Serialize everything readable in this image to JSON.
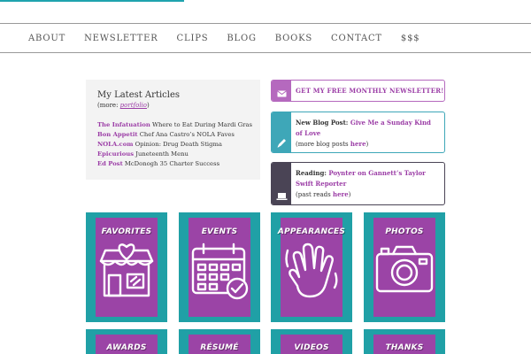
{
  "nav": {
    "items": [
      "ABOUT",
      "NEWSLETTER",
      "CLIPS",
      "BLOG",
      "BOOKS",
      "CONTACT",
      "$$$"
    ]
  },
  "articles": {
    "title": "My Latest Articles",
    "more_prefix": "(more: ",
    "more_link": "portfolio",
    "more_suffix": ")",
    "items": [
      {
        "source": "The Infatuation",
        "text": " Where to Eat During Mardi Gras"
      },
      {
        "source": "Bon Appetit",
        "text": " Chef Ana Castro’s NOLA Faves"
      },
      {
        "source": "NOLA.com",
        "text": " Opinion: Drug Death Stigma"
      },
      {
        "source": "Epicurious",
        "text": " Juneteenth Menu"
      },
      {
        "source": "Ed Post",
        "text": " McDonogh 35 Charter Success"
      }
    ]
  },
  "callouts": {
    "newsletter": {
      "label": "GET MY FREE MONTHLY NEWSLETTER!"
    },
    "blog": {
      "lead": "New Blog Post: ",
      "link": "Give Me a Sunday Kind of Love",
      "sub_prefix": "(more blog posts ",
      "sub_link": "here",
      "sub_suffix": ")"
    },
    "reading": {
      "lead": "Reading: ",
      "link": "Poynter on Gannett’s Taylor Swift Reporter",
      "sub_prefix": "(past reads ",
      "sub_link": "here",
      "sub_suffix": ")"
    }
  },
  "tiles": {
    "row1": [
      "FAVORITES",
      "EVENTS",
      "APPEARANCES",
      "PHOTOS"
    ],
    "row2": [
      "AWARDS",
      "RÉSUMÉ",
      "VIDEOS",
      "THANKS"
    ]
  },
  "colors": {
    "teal": "#20a0a6",
    "purple": "#9b44a6",
    "link": "#9b3da6"
  }
}
